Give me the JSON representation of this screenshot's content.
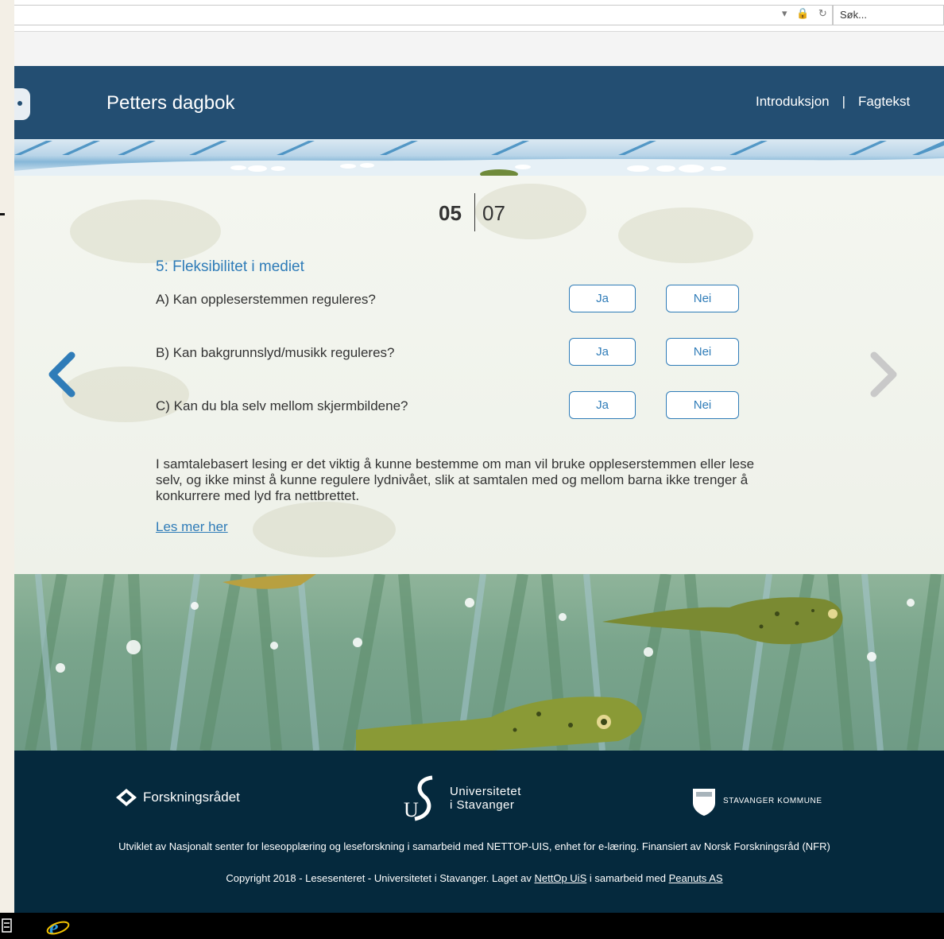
{
  "browser": {
    "search_placeholder": "Søk...",
    "address_icons": "▾ 🔒 ↻"
  },
  "header": {
    "title": "Petters dagbok",
    "nav": [
      {
        "label": "Introduksjon"
      },
      {
        "label": "Fagtekst"
      }
    ],
    "nav_separator": "|"
  },
  "counter": {
    "current": "05",
    "total": "07"
  },
  "question_section": {
    "heading": "5: Fleksibilitet i mediet",
    "questions": [
      {
        "text": "A) Kan oppleserstemmen reguleres?",
        "yes": "Ja",
        "no": "Nei"
      },
      {
        "text": "B) Kan bakgrunnslyd/musikk reguleres?",
        "yes": "Ja",
        "no": "Nei"
      },
      {
        "text": "C) Kan du bla selv mellom skjermbildene?",
        "yes": "Ja",
        "no": "Nei"
      }
    ],
    "info": "I samtalebasert lesing er det viktig å kunne bestemme om man vil bruke oppleserstemmen eller lese selv, og ikke minst å kunne regulere lydnivået, slik at samtalen med og mellom barna ikke trenger å konkurrere med lyd fra nettbrettet.",
    "read_more": "Les mer her"
  },
  "colors": {
    "header_bg": "#234e72",
    "accent": "#2f7cb8",
    "footer_bg": "#05293d"
  },
  "footer": {
    "logos": {
      "nfr": "Forskningsrådet",
      "uis_line1": "Universitetet",
      "uis_line2": "i Stavanger",
      "uis_mark": "U",
      "kommune": "STAVANGER KOMMUNE"
    },
    "credit": "Utviklet av Nasjonalt senter for leseopplæring og leseforskning i samarbeid med NETTOP-UIS, enhet for e-læring. Finansiert av Norsk Forskningsråd (NFR)",
    "copyright_prefix": "Copyright 2018 - Lesesenteret - Universitetet i Stavanger. Laget av",
    "link1": "NettOp UiS",
    "copyright_middle": "i samarbeid med",
    "link2": "Peanuts AS"
  }
}
